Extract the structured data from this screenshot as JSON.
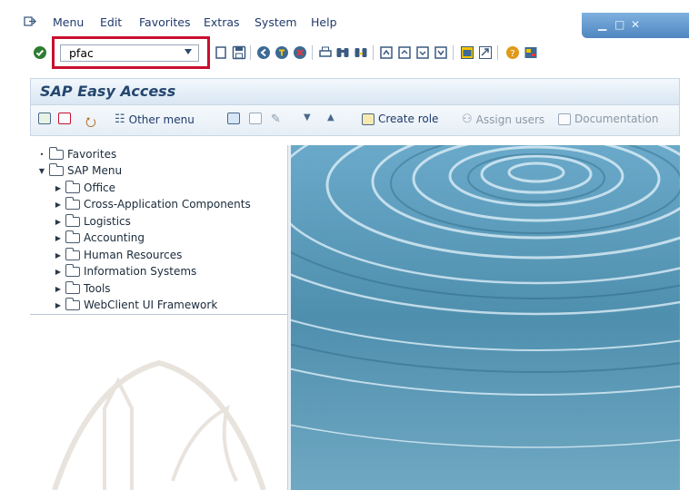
{
  "menubar": {
    "items": [
      {
        "label": "Menu"
      },
      {
        "label": "Edit"
      },
      {
        "label": "Favorites"
      },
      {
        "label": "Extras"
      },
      {
        "label": "System"
      },
      {
        "label": "Help"
      }
    ]
  },
  "toolbar": {
    "command_field_value": "pfac"
  },
  "screen": {
    "title": "SAP Easy Access"
  },
  "app_toolbar": {
    "other_menu": "Other menu",
    "create_role": "Create role",
    "assign_users": "Assign users",
    "documentation": "Documentation"
  },
  "tree": {
    "favorites": "Favorites",
    "sap_menu": "SAP Menu",
    "children": [
      {
        "label": "Office"
      },
      {
        "label": "Cross-Application Components"
      },
      {
        "label": "Logistics"
      },
      {
        "label": "Accounting"
      },
      {
        "label": "Human Resources"
      },
      {
        "label": "Information Systems"
      },
      {
        "label": "Tools"
      },
      {
        "label": "WebClient UI Framework"
      }
    ]
  },
  "colors": {
    "highlight_frame": "#c8102e",
    "title_text": "#25466e",
    "water": "#4f8fae"
  },
  "icons": [
    "exit-icon",
    "enter-icon",
    "save-icon",
    "back-icon",
    "exit-session-icon",
    "cancel-icon",
    "print-icon",
    "find-icon",
    "find-next-icon",
    "first-page-icon",
    "previous-page-icon",
    "next-page-icon",
    "last-page-icon",
    "new-session-icon",
    "shortcut-icon",
    "help-icon",
    "layout-icon"
  ]
}
